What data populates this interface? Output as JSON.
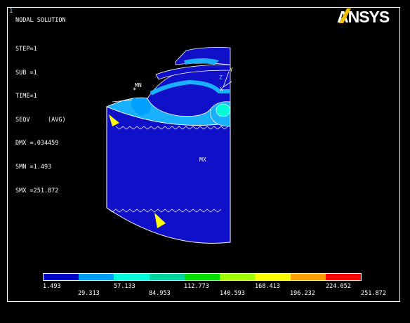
{
  "viewport": {
    "window_number": "1",
    "title": "NODAL SOLUTION",
    "stats": [
      "STEP=1",
      "SUB =1",
      "TIME=1",
      "SEQV     (AVG)",
      "DMX =.034459",
      "SMN =1.493",
      "SMX =251.872"
    ],
    "logo": "ANSYS",
    "min_marker": "MN",
    "max_marker": "MX",
    "triad": {
      "z": "Z",
      "y": "Y",
      "x": "X"
    }
  },
  "legend": {
    "values_bottom_row": [
      "1.493",
      "57.133",
      "112.773",
      "168.413",
      "224.052"
    ],
    "values_top_row": [
      "29.313",
      "84.953",
      "140.593",
      "196.232",
      "251.872"
    ],
    "colors": [
      "#0000c8",
      "#00a0ff",
      "#00ffd8",
      "#00d8a0",
      "#00e000",
      "#a0ff00",
      "#ffff00",
      "#ffa000",
      "#ff0000"
    ]
  },
  "colors": {
    "background": "#000000",
    "frame": "#ffffff",
    "model_blue": "#1010c8",
    "model_light_blue": "#18b0ff",
    "logo": "#ffffff"
  }
}
